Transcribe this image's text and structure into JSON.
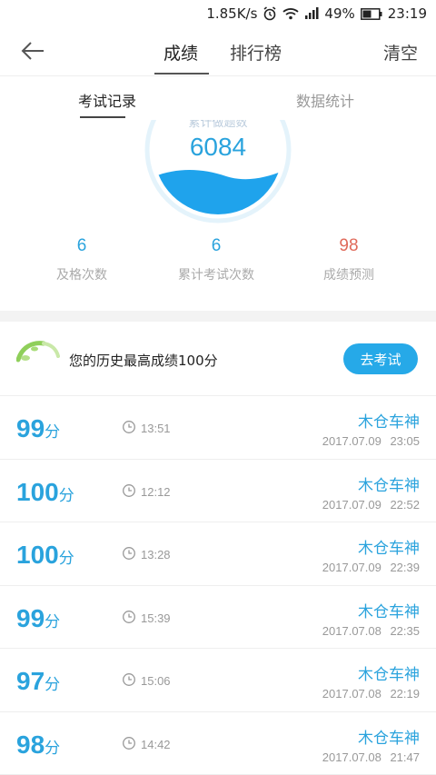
{
  "status_bar": {
    "speed": "1.85K/s",
    "battery": "49%",
    "time": "23:19"
  },
  "nav": {
    "tab_scores": "成绩",
    "tab_ranking": "排行榜",
    "clear": "清空"
  },
  "sub_tabs": {
    "records": "考试记录",
    "stats": "数据统计"
  },
  "gauge": {
    "top_label": "累计做题数",
    "value": "6084"
  },
  "stats": [
    {
      "value": "6",
      "label": "及格次数",
      "color": "#2aa3dd"
    },
    {
      "value": "6",
      "label": "累计考试次数",
      "color": "#2aa3dd"
    },
    {
      "value": "98",
      "label": "成绩预测",
      "color": "#e06a5a"
    }
  ],
  "best": {
    "text": "您的历史最高成绩100分",
    "button": "去考试"
  },
  "records": [
    {
      "score": "99",
      "unit": "分",
      "duration": "13:51",
      "name": "木仓车神",
      "datetime": "2017.07.09 23:05"
    },
    {
      "score": "100",
      "unit": "分",
      "duration": "12:12",
      "name": "木仓车神",
      "datetime": "2017.07.09 22:52"
    },
    {
      "score": "100",
      "unit": "分",
      "duration": "13:28",
      "name": "木仓车神",
      "datetime": "2017.07.09 22:39"
    },
    {
      "score": "99",
      "unit": "分",
      "duration": "15:39",
      "name": "木仓车神",
      "datetime": "2017.07.08 22:35"
    },
    {
      "score": "97",
      "unit": "分",
      "duration": "15:06",
      "name": "木仓车神",
      "datetime": "2017.07.08 22:19"
    },
    {
      "score": "98",
      "unit": "分",
      "duration": "14:42",
      "name": "木仓车神",
      "datetime": "2017.07.08 21:47"
    }
  ],
  "colors": {
    "accent": "#26a9e8",
    "prediction": "#e06a5a"
  }
}
